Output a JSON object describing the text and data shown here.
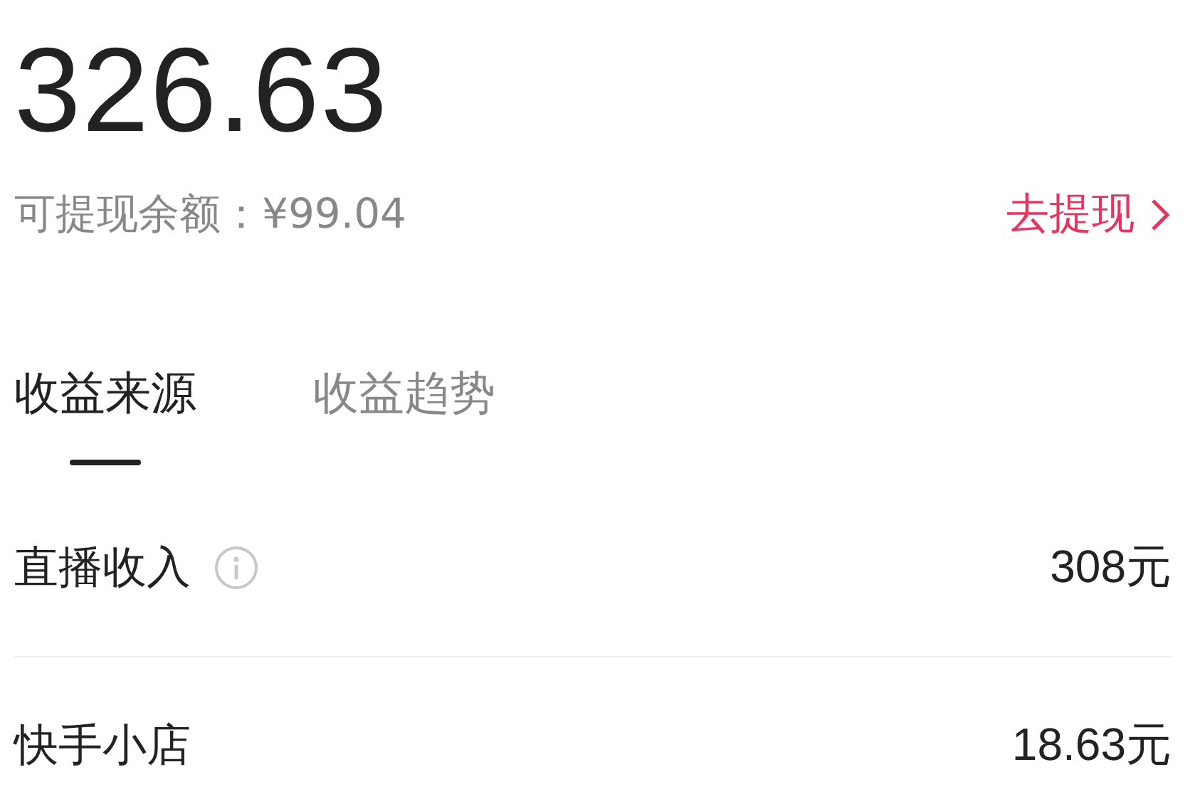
{
  "total": "326.63",
  "withdrawable": {
    "label": "可提现余额：¥99.04",
    "action": "去提现"
  },
  "tabs": [
    {
      "label": "收益来源",
      "selected": true
    },
    {
      "label": "收益趋势",
      "selected": false
    }
  ],
  "rows": [
    {
      "label": "直播收入",
      "info": true,
      "value": "308元"
    },
    {
      "label": "快手小店",
      "info": false,
      "value": "18.63元"
    }
  ]
}
